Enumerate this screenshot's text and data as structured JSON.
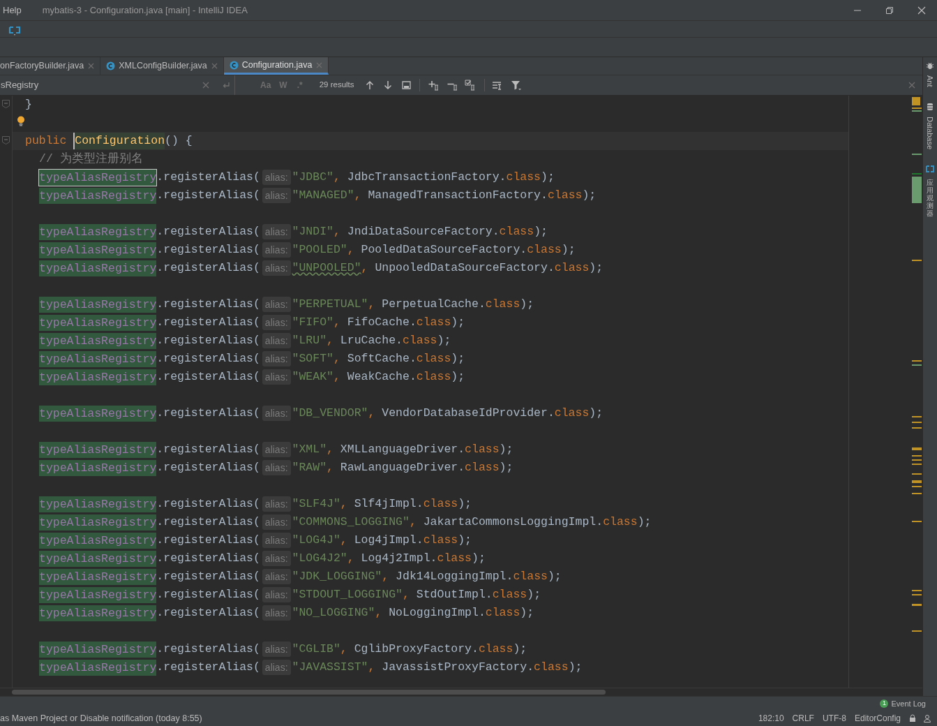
{
  "window": {
    "menu": "Help",
    "title": "mybatis-3 - Configuration.java [main] - IntelliJ IDEA"
  },
  "tabs": [
    {
      "label": "onFactoryBuilder.java",
      "selected": false,
      "file_icon": false
    },
    {
      "label": "XMLConfigBuilder.java",
      "selected": false,
      "file_icon": true
    },
    {
      "label": "Configuration.java",
      "selected": true,
      "file_icon": true
    }
  ],
  "find_bar": {
    "value": "sRegistry",
    "match_case": "Aa",
    "words": "W",
    "regex": ".*",
    "results": "29 results"
  },
  "lines": [
    {
      "kind": "brace",
      "text": "}",
      "fold": true
    },
    {
      "kind": "bulb"
    },
    {
      "kind": "ctor",
      "keyword": "public",
      "name": "Configuration",
      "rest": "() {",
      "fold": true
    },
    {
      "kind": "comment",
      "text": "// 为类型注册别名"
    },
    {
      "kind": "call",
      "field": "typeAliasRegistry",
      "current": true,
      "method": ".registerAlias(",
      "hint": "alias:",
      "arg": "\"JDBC\"",
      "comma": ",",
      "type": "JdbcTransactionFactory",
      "dot": ".",
      "kw": "class",
      "close": ");",
      "typo": false
    },
    {
      "kind": "call",
      "field": "typeAliasRegistry",
      "current": false,
      "method": ".registerAlias(",
      "hint": "alias:",
      "arg": "\"MANAGED\"",
      "comma": ",",
      "type": "ManagedTransactionFactory",
      "dot": ".",
      "kw": "class",
      "close": ");",
      "typo": false
    },
    {
      "kind": "blank"
    },
    {
      "kind": "call",
      "field": "typeAliasRegistry",
      "current": false,
      "method": ".registerAlias(",
      "hint": "alias:",
      "arg": "\"JNDI\"",
      "comma": ",",
      "type": "JndiDataSourceFactory",
      "dot": ".",
      "kw": "class",
      "close": ");",
      "typo": false
    },
    {
      "kind": "call",
      "field": "typeAliasRegistry",
      "current": false,
      "method": ".registerAlias(",
      "hint": "alias:",
      "arg": "\"POOLED\"",
      "comma": ",",
      "type": "PooledDataSourceFactory",
      "dot": ".",
      "kw": "class",
      "close": ");",
      "typo": false
    },
    {
      "kind": "call",
      "field": "typeAliasRegistry",
      "current": false,
      "method": ".registerAlias(",
      "hint": "alias:",
      "arg": "\"UNPOOLED\"",
      "comma": ",",
      "type": "UnpooledDataSourceFactory",
      "dot": ".",
      "kw": "class",
      "close": ");",
      "typo": true
    },
    {
      "kind": "blank"
    },
    {
      "kind": "call",
      "field": "typeAliasRegistry",
      "current": false,
      "method": ".registerAlias(",
      "hint": "alias:",
      "arg": "\"PERPETUAL\"",
      "comma": ",",
      "type": "PerpetualCache",
      "dot": ".",
      "kw": "class",
      "close": ");",
      "typo": false
    },
    {
      "kind": "call",
      "field": "typeAliasRegistry",
      "current": false,
      "method": ".registerAlias(",
      "hint": "alias:",
      "arg": "\"FIFO\"",
      "comma": ",",
      "type": "FifoCache",
      "dot": ".",
      "kw": "class",
      "close": ");",
      "typo": false
    },
    {
      "kind": "call",
      "field": "typeAliasRegistry",
      "current": false,
      "method": ".registerAlias(",
      "hint": "alias:",
      "arg": "\"LRU\"",
      "comma": ",",
      "type": "LruCache",
      "dot": ".",
      "kw": "class",
      "close": ");",
      "typo": false
    },
    {
      "kind": "call",
      "field": "typeAliasRegistry",
      "current": false,
      "method": ".registerAlias(",
      "hint": "alias:",
      "arg": "\"SOFT\"",
      "comma": ",",
      "type": "SoftCache",
      "dot": ".",
      "kw": "class",
      "close": ");",
      "typo": false
    },
    {
      "kind": "call",
      "field": "typeAliasRegistry",
      "current": false,
      "method": ".registerAlias(",
      "hint": "alias:",
      "arg": "\"WEAK\"",
      "comma": ",",
      "type": "WeakCache",
      "dot": ".",
      "kw": "class",
      "close": ");",
      "typo": false
    },
    {
      "kind": "blank"
    },
    {
      "kind": "call",
      "field": "typeAliasRegistry",
      "current": false,
      "method": ".registerAlias(",
      "hint": "alias:",
      "arg": "\"DB_VENDOR\"",
      "comma": ",",
      "type": "VendorDatabaseIdProvider",
      "dot": ".",
      "kw": "class",
      "close": ");",
      "typo": false
    },
    {
      "kind": "blank"
    },
    {
      "kind": "call",
      "field": "typeAliasRegistry",
      "current": false,
      "method": ".registerAlias(",
      "hint": "alias:",
      "arg": "\"XML\"",
      "comma": ",",
      "type": "XMLLanguageDriver",
      "dot": ".",
      "kw": "class",
      "close": ");",
      "typo": false
    },
    {
      "kind": "call",
      "field": "typeAliasRegistry",
      "current": false,
      "method": ".registerAlias(",
      "hint": "alias:",
      "arg": "\"RAW\"",
      "comma": ",",
      "type": "RawLanguageDriver",
      "dot": ".",
      "kw": "class",
      "close": ");",
      "typo": false
    },
    {
      "kind": "blank"
    },
    {
      "kind": "call",
      "field": "typeAliasRegistry",
      "current": false,
      "method": ".registerAlias(",
      "hint": "alias:",
      "arg": "\"SLF4J\"",
      "comma": ",",
      "type": "Slf4jImpl",
      "dot": ".",
      "kw": "class",
      "close": ");",
      "typo": false
    },
    {
      "kind": "call",
      "field": "typeAliasRegistry",
      "current": false,
      "method": ".registerAlias(",
      "hint": "alias:",
      "arg": "\"COMMONS_LOGGING\"",
      "comma": ",",
      "type": "JakartaCommonsLoggingImpl",
      "dot": ".",
      "kw": "class",
      "close": ");",
      "typo": false
    },
    {
      "kind": "call",
      "field": "typeAliasRegistry",
      "current": false,
      "method": ".registerAlias(",
      "hint": "alias:",
      "arg": "\"LOG4J\"",
      "comma": ",",
      "type": "Log4jImpl",
      "dot": ".",
      "kw": "class",
      "close": ");",
      "typo": false
    },
    {
      "kind": "call",
      "field": "typeAliasRegistry",
      "current": false,
      "method": ".registerAlias(",
      "hint": "alias:",
      "arg": "\"LOG4J2\"",
      "comma": ",",
      "type": "Log4j2Impl",
      "dot": ".",
      "kw": "class",
      "close": ");",
      "typo": false
    },
    {
      "kind": "call",
      "field": "typeAliasRegistry",
      "current": false,
      "method": ".registerAlias(",
      "hint": "alias:",
      "arg": "\"JDK_LOGGING\"",
      "comma": ",",
      "type": "Jdk14LoggingImpl",
      "dot": ".",
      "kw": "class",
      "close": ");",
      "typo": false
    },
    {
      "kind": "call",
      "field": "typeAliasRegistry",
      "current": false,
      "method": ".registerAlias(",
      "hint": "alias:",
      "arg": "\"STDOUT_LOGGING\"",
      "comma": ",",
      "type": "StdOutImpl",
      "dot": ".",
      "kw": "class",
      "close": ");",
      "typo": false
    },
    {
      "kind": "call",
      "field": "typeAliasRegistry",
      "current": false,
      "method": ".registerAlias(",
      "hint": "alias:",
      "arg": "\"NO_LOGGING\"",
      "comma": ",",
      "type": "NoLoggingImpl",
      "dot": ".",
      "kw": "class",
      "close": ");",
      "typo": false
    },
    {
      "kind": "blank"
    },
    {
      "kind": "call",
      "field": "typeAliasRegistry",
      "current": false,
      "method": ".registerAlias(",
      "hint": "alias:",
      "arg": "\"CGLIB\"",
      "comma": ",",
      "type": "CglibProxyFactory",
      "dot": ".",
      "kw": "class",
      "close": ");",
      "typo": false
    },
    {
      "kind": "call",
      "field": "typeAliasRegistry",
      "current": false,
      "method": ".registerAlias(",
      "hint": "alias:",
      "arg": "\"JAVASSIST\"",
      "comma": ",",
      "type": "JavassistProxyFactory",
      "dot": ".",
      "kw": "class",
      "close": ");",
      "typo": false
    }
  ],
  "side_tools": [
    {
      "label": "Ant",
      "kind": "latin"
    },
    {
      "label": "Database",
      "kind": "latin"
    },
    {
      "label": "应用观测器",
      "kind": "cjk"
    }
  ],
  "event_log": {
    "count": "1",
    "label": "Event Log"
  },
  "status_bar": {
    "message": "as Maven Project or Disable notification (today 8:55)",
    "position": "182:10",
    "line_separator": "CRLF",
    "encoding": "UTF-8",
    "editor_config": "EditorConfig"
  }
}
